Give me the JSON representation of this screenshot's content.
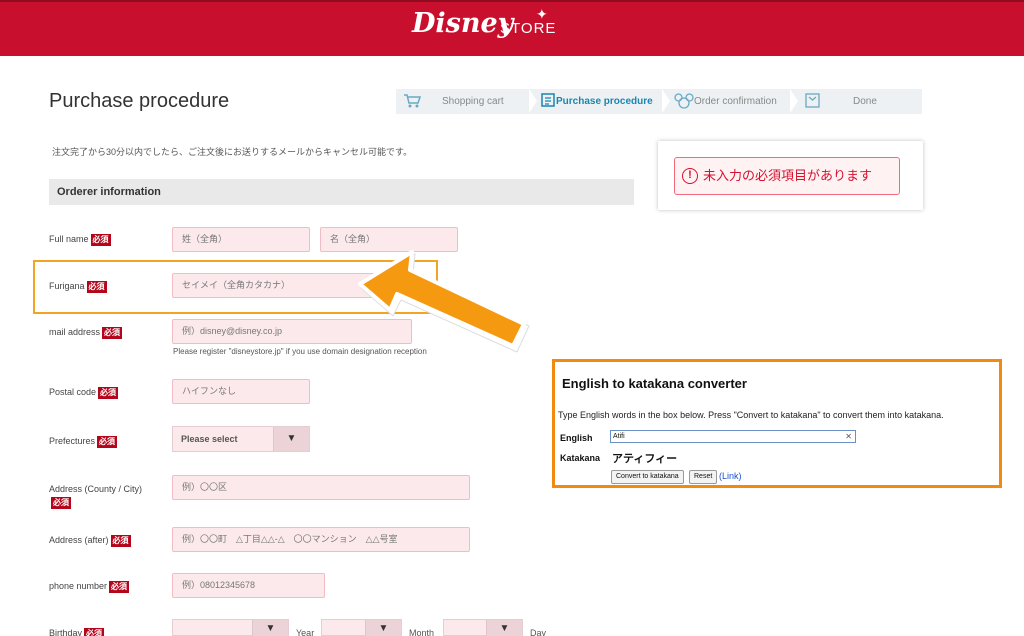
{
  "header": {
    "logo_disney": "Disney",
    "logo_store": "STORE"
  },
  "page": {
    "title": "Purchase procedure",
    "notice": "注文完了から30分以内でしたら、ご注文後にお送りするメールからキャンセル可能です。"
  },
  "steps": [
    {
      "label": "Shopping cart",
      "icon": "cart-icon"
    },
    {
      "label": "Purchase procedure",
      "icon": "form-icon",
      "active": true
    },
    {
      "label": "Order confirmation",
      "icon": "mickey-icon"
    },
    {
      "label": "Done",
      "icon": "check-icon"
    }
  ],
  "section": {
    "title": "Orderer information"
  },
  "form": {
    "required_badge": "必須",
    "fullname": {
      "label": "Full name",
      "last_placeholder": "姓（全角）",
      "first_placeholder": "名（全角）"
    },
    "furigana": {
      "label": "Furigana",
      "placeholder": "セイメイ（全角カタカナ）"
    },
    "mail": {
      "label": "mail address",
      "placeholder": "例）disney@disney.co.jp",
      "hint": "Please register \"disneystore.jp\" if you use domain designation reception"
    },
    "postal": {
      "label": "Postal code",
      "placeholder": "ハイフンなし"
    },
    "prefecture": {
      "label": "Prefectures",
      "selected": "Please select"
    },
    "address_city": {
      "label": "Address (County / City)",
      "placeholder": "例）〇〇区"
    },
    "address_after": {
      "label": "Address (after)",
      "placeholder": "例）〇〇町　△丁目△△-△　〇〇マンション　△△号室"
    },
    "phone": {
      "label": "phone number",
      "placeholder": "例）08012345678"
    },
    "birthday": {
      "label": "Birthday",
      "year_label": "Year",
      "month_label": "Month",
      "day_label": "Day"
    }
  },
  "error": {
    "message": "未入力の必須項目があります",
    "icon": "exclamation-circle-icon"
  },
  "converter": {
    "title": "English to katakana converter",
    "description": "Type English words in the box below. Press \"Convert to katakana\" to convert them into katakana.",
    "english_label": "English",
    "english_value": "Atifi",
    "katakana_label": "Katakana",
    "katakana_value": "アティフィー",
    "convert_button": "Convert to katakana",
    "reset_button": "Reset",
    "link_text": "(Link)"
  },
  "colors": {
    "brand_red": "#c8102e",
    "required_red": "#b5051b",
    "field_bg": "#fbe9ec",
    "highlight_orange": "#f2a524",
    "converter_border": "#f28a12",
    "active_step": "#1a86b0"
  }
}
